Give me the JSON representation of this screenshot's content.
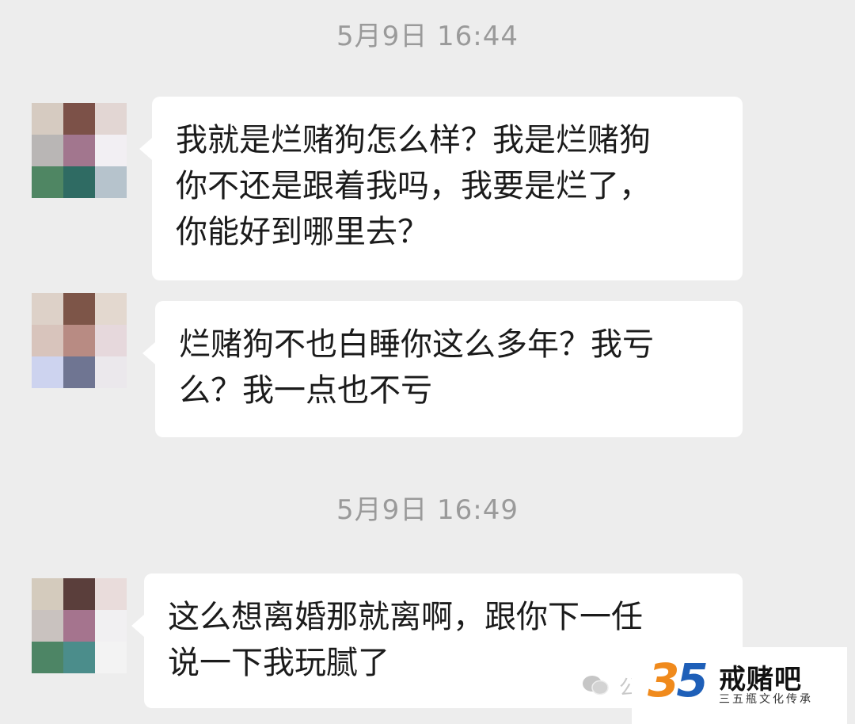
{
  "chat": {
    "timestamps": [
      "5月9日 16:44",
      "5月9日 16:49"
    ],
    "messages": [
      {
        "lines": [
          "我就是烂赌狗怎么样？我是烂赌狗",
          "你不还是跟着我吗，我要是烂了，",
          "你能好到哪里去？"
        ]
      },
      {
        "lines": [
          "烂赌狗不也白睡你这么多年？我亏",
          "么？我一点也不亏"
        ]
      },
      {
        "lines": [
          "这么想离婚那就离啊，跟你下一任",
          "说一下我玩腻了"
        ]
      }
    ],
    "avatar_colors": [
      [
        "#d6cbc1",
        "#7c5148",
        "#e2d6d3",
        "#b9b6b5",
        "#a2768e",
        "#f2eff3",
        "#4f8663",
        "#2f6b63",
        "#b6c3cc"
      ],
      [
        "#ddd1c8",
        "#7d5548",
        "#e3d8cf",
        "#d8c4bc",
        "#b88b83",
        "#e6d8dc",
        "#cdd3ef",
        "#6f7592",
        "#ebe8ec"
      ],
      [
        "#d4cbbd",
        "#5a3e3b",
        "#e9dcdb",
        "#c9c2bf",
        "#a5748e",
        "#f1f0f2",
        "#4d8565",
        "#4b8d8b",
        "#f3f3f3"
      ]
    ]
  },
  "watermark": {
    "logo_digits": [
      "3",
      "5"
    ],
    "name": "戒赌吧",
    "subtitle": "三五瓶文化传承",
    "ghost_text": "公"
  }
}
